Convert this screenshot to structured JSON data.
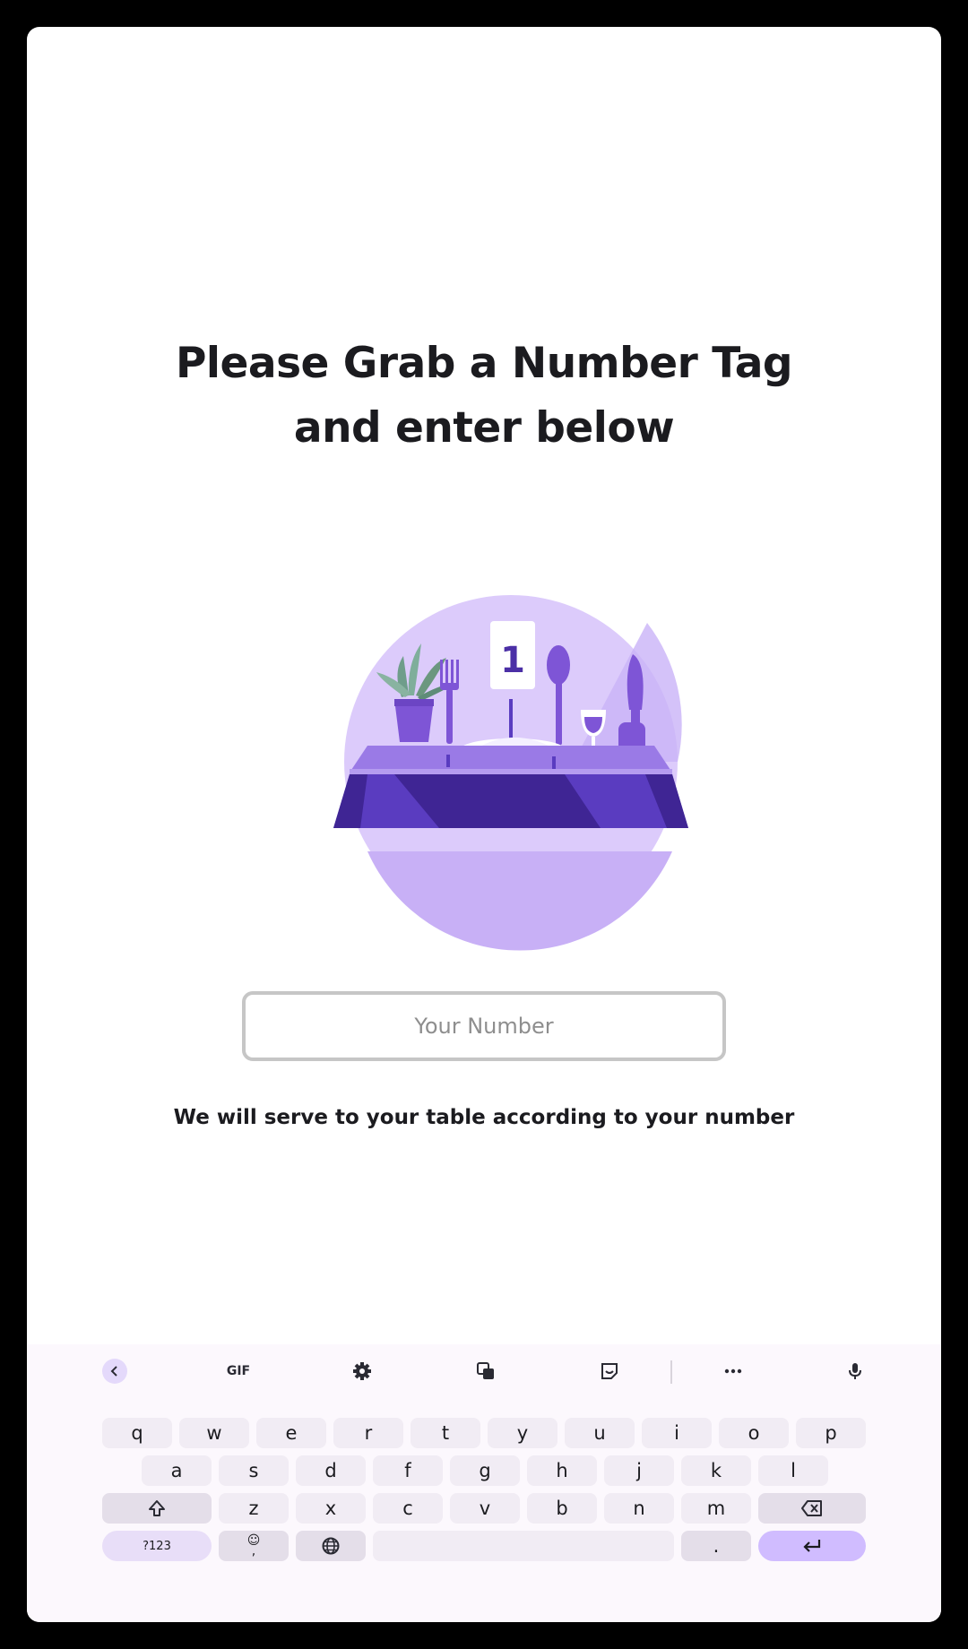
{
  "title": {
    "line1": "Please Grab a Number Tag",
    "line2": "and enter below"
  },
  "illustration": {
    "tag_number": "1",
    "colors": {
      "circle": "#dccbfb",
      "table_dark": "#3f2594",
      "table_mid": "#5a3cc0",
      "accent": "#7e55d6",
      "plant": "#7fa99a"
    }
  },
  "input": {
    "placeholder": "Your Number",
    "value": ""
  },
  "hint": "We will serve to your table according to your number",
  "keyboard": {
    "toolbar": {
      "back_icon": "chevron-left-icon",
      "gif_label": "GIF",
      "settings_icon": "gear-icon",
      "translate_icon": "translate-icon",
      "sticker_icon": "sticker-icon",
      "more_icon": "more-horizontal-icon",
      "mic_icon": "microphone-icon"
    },
    "row1": [
      "q",
      "w",
      "e",
      "r",
      "t",
      "y",
      "u",
      "i",
      "o",
      "p"
    ],
    "row2": [
      "a",
      "s",
      "d",
      "f",
      "g",
      "h",
      "j",
      "k",
      "l"
    ],
    "row3": [
      "z",
      "x",
      "c",
      "v",
      "b",
      "n",
      "m"
    ],
    "symbols_label": "?123",
    "comma_label": ",",
    "period_label": ".",
    "accent_color": "#d0bcff"
  }
}
